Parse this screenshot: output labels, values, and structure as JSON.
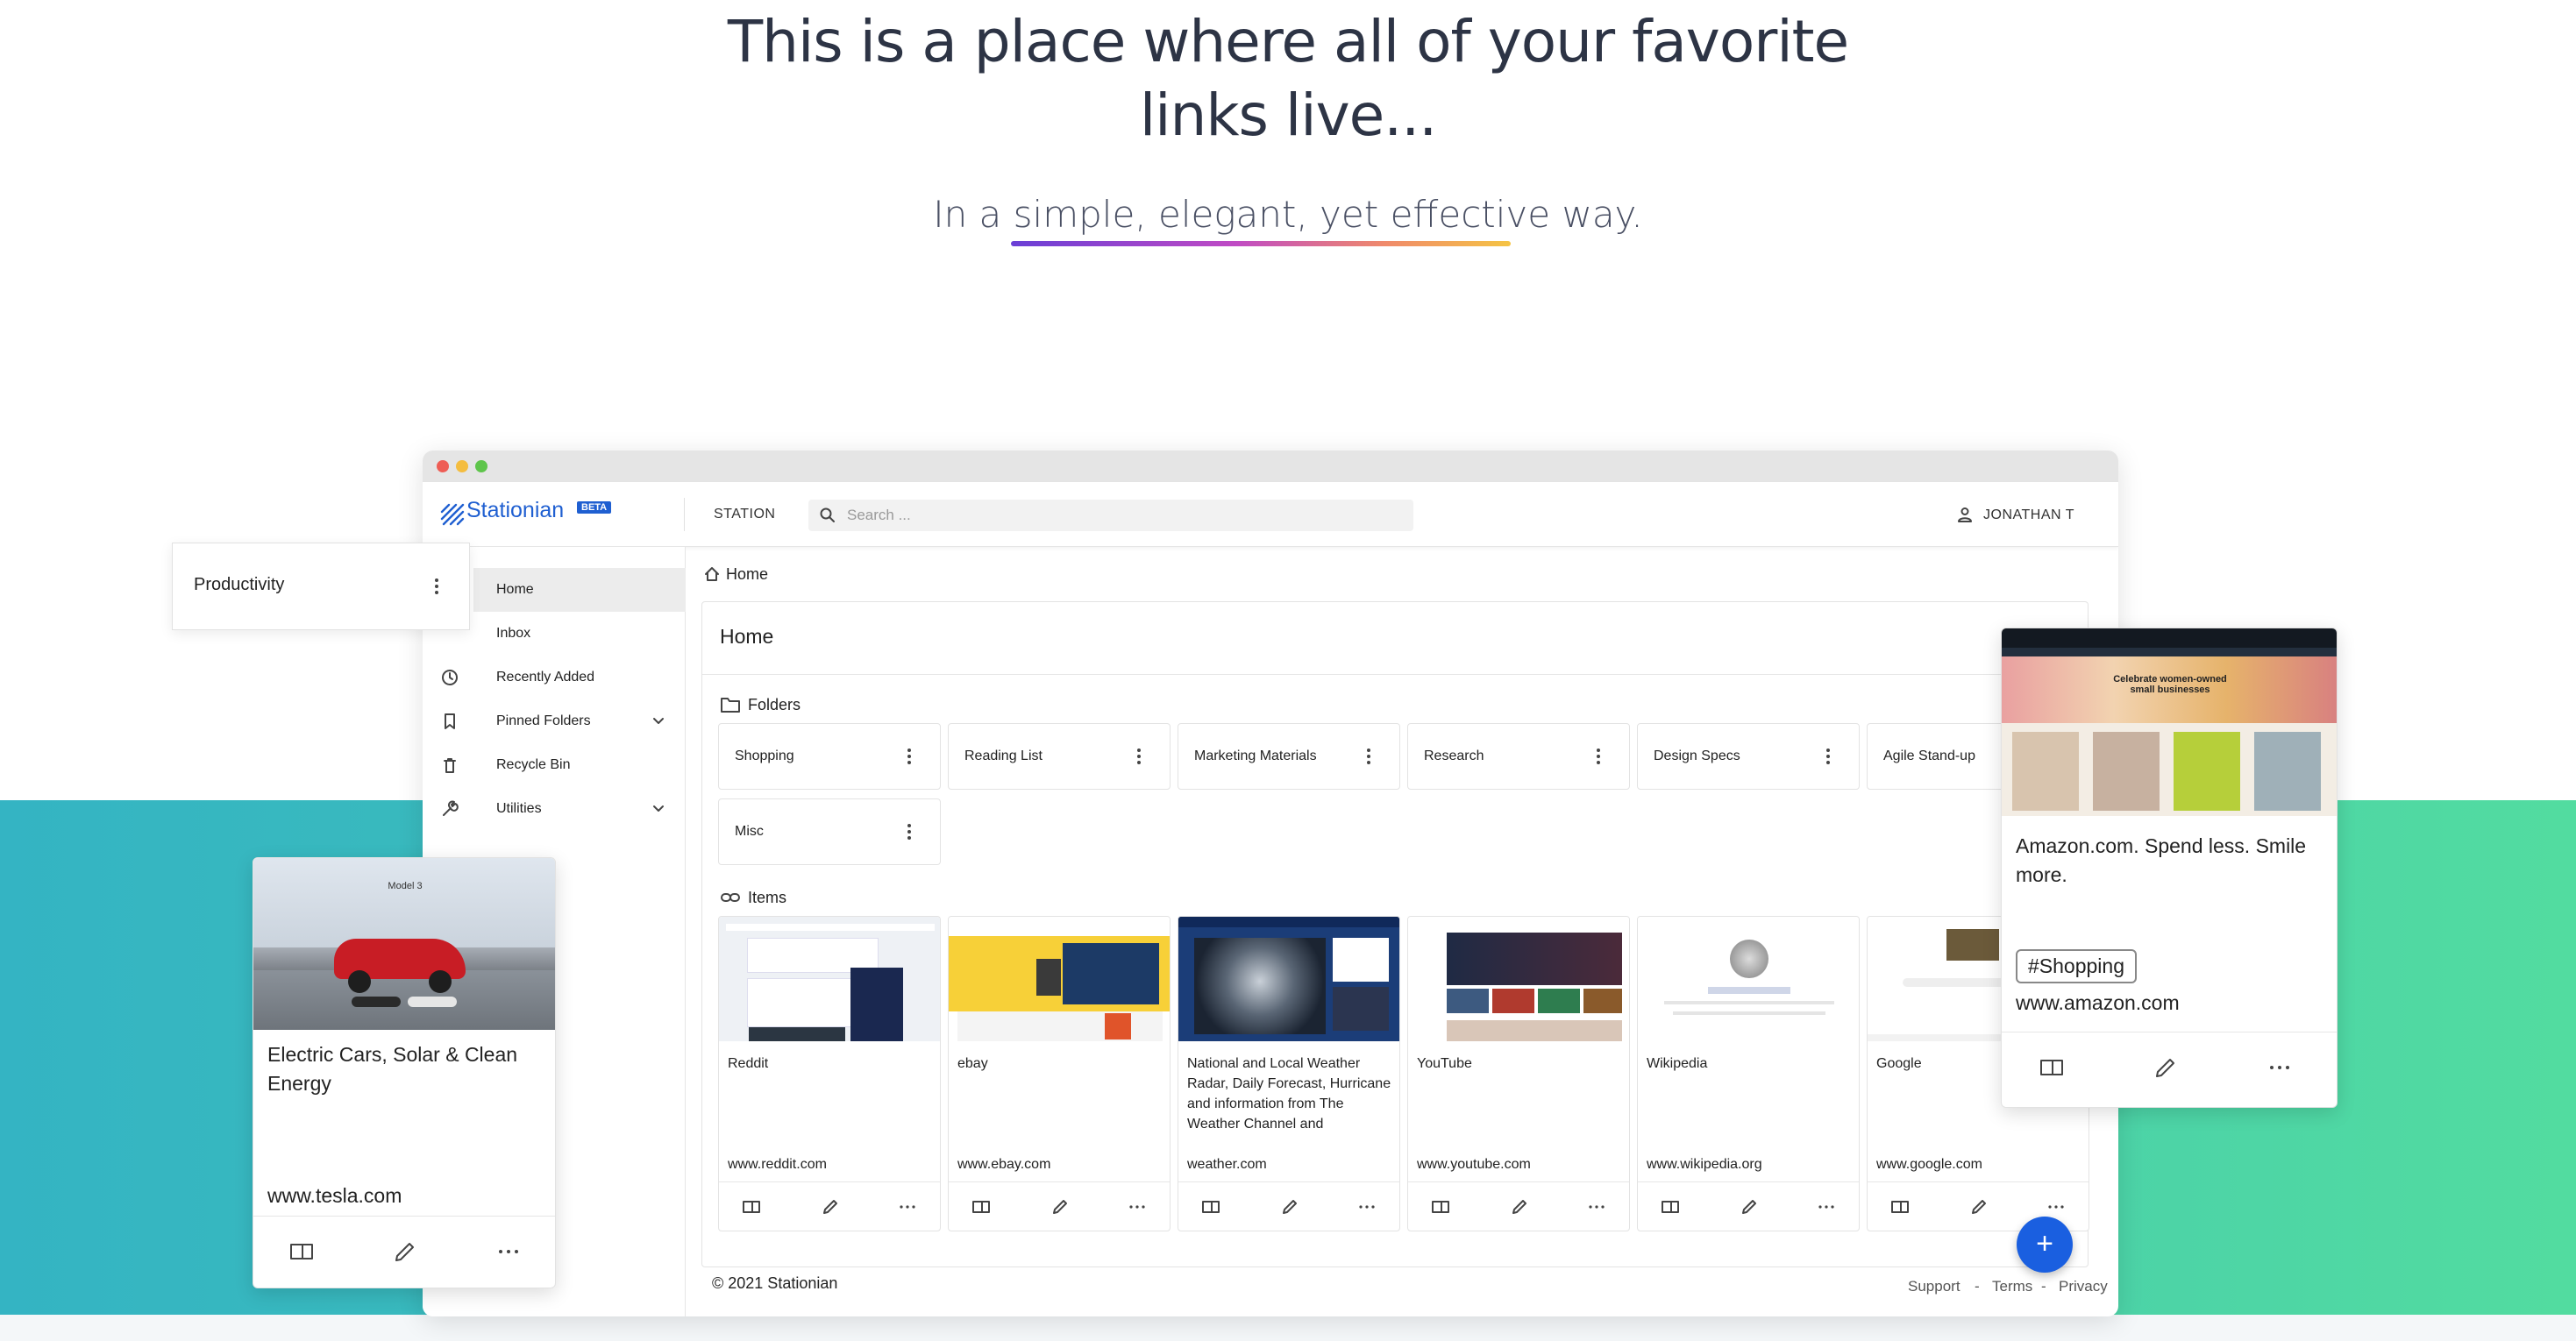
{
  "hero": {
    "headline_line1": "This is a place where all of your favorite",
    "headline_line2": "links live...",
    "subline": "In a simple, elegant, yet effective way."
  },
  "app": {
    "logo_text": "Stationian",
    "beta_badge": "BETA",
    "station_label": "STATION",
    "search_placeholder": "Search ...",
    "user_name": "JONATHAN T"
  },
  "sidebar": {
    "items": [
      {
        "label": "Home",
        "icon": "home-icon"
      },
      {
        "label": "Inbox",
        "icon": "inbox-icon"
      },
      {
        "label": "Recently Added",
        "icon": "clock-icon"
      },
      {
        "label": "Pinned Folders",
        "icon": "bookmark-icon"
      },
      {
        "label": "Recycle Bin",
        "icon": "trash-icon"
      },
      {
        "label": "Utilities",
        "icon": "wrench-icon"
      }
    ]
  },
  "floating_folder": {
    "label": "Productivity"
  },
  "main": {
    "breadcrumb": "Home",
    "title": "Home",
    "folders_label": "Folders",
    "items_label": "Items",
    "folders": [
      "Shopping",
      "Reading List",
      "Marketing Materials",
      "Research",
      "Design Specs",
      "Agile Stand-up",
      "Misc"
    ],
    "items": [
      {
        "title": "Reddit",
        "url": "www.reddit.com"
      },
      {
        "title": "ebay",
        "url": "www.ebay.com"
      },
      {
        "title": "National and Local Weather Radar, Daily Forecast, Hurricane and information from The Weather Channel and",
        "url": "weather.com"
      },
      {
        "title": "YouTube",
        "url": "www.youtube.com"
      },
      {
        "title": "Wikipedia",
        "url": "www.wikipedia.org"
      },
      {
        "title": "Google",
        "url": "www.google.com"
      }
    ],
    "fab": "+",
    "footer_copy": "© 2021 Stationian",
    "footer_support": "Support",
    "footer_terms": "Terms",
    "footer_privacy": "Privacy",
    "footer_sep": "-"
  },
  "tesla_card": {
    "title": "Electric Cars, Solar & Clean Energy",
    "url": "www.tesla.com",
    "thumb_text": "Model 3"
  },
  "amazon_card": {
    "title": "Amazon.com. Spend less. Smile more.",
    "tag": "#Shopping",
    "url": "www.amazon.com",
    "thumb_text": "Celebrate women-owned small businesses"
  },
  "colors": {
    "brand": "#1f5fd1",
    "fab": "#1a5fe0",
    "band_left": "#34b4c3",
    "band_right": "#52dca0"
  }
}
